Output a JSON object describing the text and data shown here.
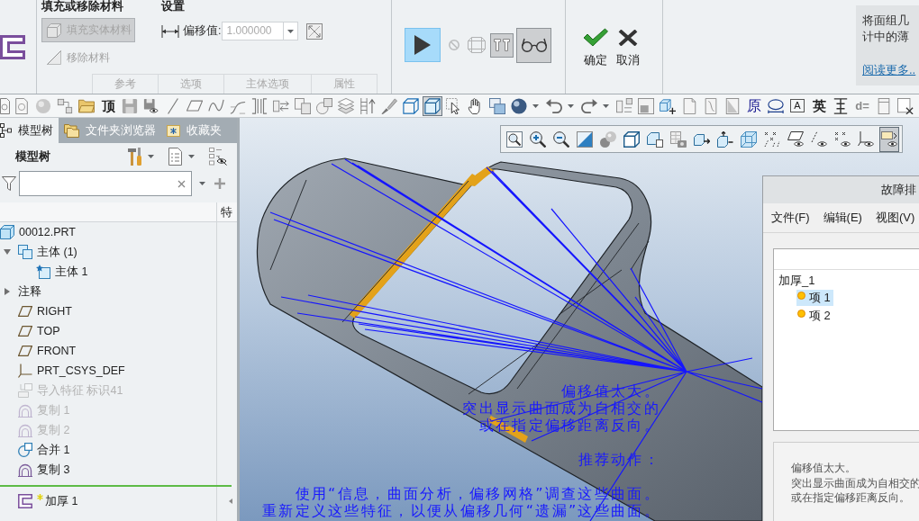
{
  "ribbon": {
    "fill_group": {
      "title": "填充或移除材料",
      "fill_button": {
        "label": "填充实体材料",
        "selected": true,
        "disabled": true
      },
      "remove_button": {
        "label": "移除材料",
        "disabled": true
      }
    },
    "settings_group": {
      "title": "设置",
      "offset_label": "偏移值:",
      "offset_value": "1.000000",
      "offset_disabled": true
    },
    "tabs": [
      {
        "label": "参考",
        "selected": false,
        "disabled": true
      },
      {
        "label": "选项",
        "selected": false,
        "disabled": true
      },
      {
        "label": "主体选项",
        "selected": false,
        "disabled": true
      },
      {
        "label": "属性",
        "selected": false,
        "disabled": true
      }
    ],
    "preview_tools": [
      {
        "kind": "play",
        "selected": true,
        "disabled": false
      },
      {
        "kind": "stop",
        "selected": false,
        "disabled": true
      },
      {
        "kind": "wireframe",
        "selected": false,
        "disabled": true
      },
      {
        "kind": "preview",
        "selected": true,
        "disabled": false
      },
      {
        "kind": "glasses",
        "selected": true,
        "disabled": false
      }
    ],
    "actions": [
      {
        "kind": "confirm",
        "label": "确定"
      },
      {
        "kind": "cancel",
        "label": "取消"
      }
    ],
    "help": {
      "text": [
        "将面组几",
        "计中的薄"
      ],
      "link": "阅读更多.."
    }
  },
  "toolbar": {
    "items": [
      {
        "selected": false
      },
      {
        "selected": false
      },
      {
        "selected": false
      },
      {
        "selected": false
      },
      {
        "selected": false
      },
      {
        "label": "顶",
        "selected": false
      },
      {
        "selected": false
      },
      {
        "selected": false
      },
      {
        "selected": false
      },
      {
        "selected": false
      },
      {
        "selected": false
      },
      {
        "selected": false
      },
      {
        "selected": false
      },
      {
        "selected": false
      },
      {
        "selected": false
      },
      {
        "selected": false
      },
      {
        "selected": false
      },
      {
        "selected": false
      },
      {
        "selected": false
      },
      {
        "selected": false
      },
      {
        "selected": true
      },
      {
        "selected": false
      },
      {
        "selected": false
      },
      {
        "selected": false
      },
      {
        "selected": false
      },
      {
        "selected": false
      },
      {
        "selected": false
      },
      {
        "selected": false
      },
      {
        "selected": false
      },
      {
        "selected": false
      },
      {
        "selected": false
      },
      {
        "selected": false
      },
      {
        "selected": false
      },
      {
        "label": "原",
        "selected": false
      },
      {
        "selected": false
      },
      {
        "label": "A",
        "selected": false
      },
      {
        "label": "英",
        "selected": false
      },
      {
        "selected": false
      },
      {
        "label": "d=",
        "selected": false
      },
      {
        "selected": false
      },
      {
        "selected": false
      }
    ]
  },
  "model_tree": {
    "tabs": [
      {
        "label": "模型树",
        "selected": true
      },
      {
        "label": "文件夹浏览器",
        "selected": false
      },
      {
        "label": "收藏夹",
        "selected": false
      }
    ],
    "title": "模型树",
    "column": "特",
    "items": [
      {
        "label": "00012.PRT",
        "kind": "part",
        "disabled": false,
        "children": [
          {
            "label": "主体 (1)",
            "kind": "bodies",
            "disabled": false,
            "expanded": true,
            "children": [
              {
                "label": "主体 1",
                "kind": "body",
                "disabled": false
              }
            ]
          },
          {
            "label": "注释",
            "kind": "annotation",
            "disabled": false,
            "expanded": false
          },
          {
            "label": "RIGHT",
            "kind": "plane",
            "disabled": false
          },
          {
            "label": "TOP",
            "kind": "plane",
            "disabled": false
          },
          {
            "label": "FRONT",
            "kind": "plane",
            "disabled": false
          },
          {
            "label": "PRT_CSYS_DEF",
            "kind": "csys",
            "disabled": false
          },
          {
            "label": "导入特征 标识41",
            "kind": "import",
            "disabled": true
          },
          {
            "label": "复制 1",
            "kind": "copy",
            "disabled": true
          },
          {
            "label": "复制 2",
            "kind": "copy",
            "disabled": true
          },
          {
            "label": "合并 1",
            "kind": "merge",
            "disabled": false
          },
          {
            "label": "复制 3",
            "kind": "copy",
            "disabled": false
          }
        ]
      }
    ],
    "insert_item": {
      "label": "加厚 1",
      "kind": "thicken",
      "new": true
    }
  },
  "graphics": {
    "view_toolbar": [
      {
        "selected": false
      },
      {
        "selected": false
      },
      {
        "selected": false
      },
      {
        "selected": false
      },
      {
        "selected": false
      },
      {
        "selected": false
      },
      {
        "selected": false
      },
      {
        "selected": false
      },
      {
        "selected": false
      },
      {
        "selected": false
      },
      {
        "selected": false
      },
      {
        "selected": false
      },
      {
        "selected": false
      },
      {
        "selected": false
      },
      {
        "selected": false
      },
      {
        "selected": false
      },
      {
        "selected": true
      }
    ],
    "message": {
      "lines": [
        "偏移值太大。",
        "突出显示曲面成为自相交的",
        "或在指定偏移距离反向。"
      ],
      "action_title": "推荐动作：",
      "actions": [
        "使用“信息，曲面分析，偏移网格”调查这些曲面。",
        "重新定义这些特征，以便从偏移几何“遗漏”这些曲面。"
      ]
    }
  },
  "dialog": {
    "title": "故障排",
    "menu": [
      "文件(F)",
      "编辑(E)",
      "视图(V)"
    ],
    "tree": {
      "label": "加厚_1",
      "children": [
        {
          "label": "项 1",
          "selected": true
        },
        {
          "label": "项 2",
          "selected": false
        }
      ]
    },
    "details": [
      "偏移值太大。",
      "突出显示曲面成为自相交的",
      "或在指定偏移距离反向。"
    ]
  }
}
